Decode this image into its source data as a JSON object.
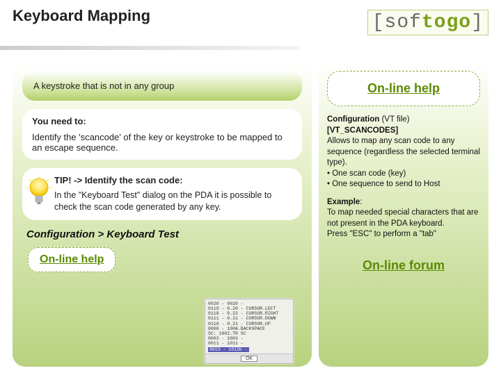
{
  "header": {
    "title": "Keyboard Mapping",
    "logo_pre": "[sof",
    "logo_accent": "togo",
    "logo_post": "]"
  },
  "left": {
    "banner": "A keystroke that is not in any group",
    "need_heading": "You need to:",
    "need_text": "Identify the 'scancode' of the key or keystroke to be mapped to an escape sequence.",
    "tip_heading": "TIP! -> Identify the scan code:",
    "tip_text": "In the \"Keyboard Test\" dialog  on the PDA it is possible to check the scan code generated by any key.",
    "config_path": "Configuration >  Keyboard Test",
    "onhelp_label": "On-line help"
  },
  "pda": {
    "lines": [
      "0020 - 0020 -",
      "0119 - 0.20 - CURSOR.LEFT",
      "0118 - 0.22 - CURSOR.RIGHT",
      "0111 - 0.21 - CURSOR.DOWN",
      "0118 - 0.21 - CURSOR.UP",
      "0008 - 100A.BACKSPACE",
      "SC: 1002.TR SC",
      "0003 - 1003 -",
      "0011 - 1011 -"
    ],
    "highlight": "0013 - 1013b -",
    "ok_label": "OK"
  },
  "right": {
    "onhelp_label": "On-line help",
    "config_heading": "Configuration",
    "config_suffix": " (VT file)",
    "section": "[VT_SCANCODES]",
    "desc": "Allows to map any scan code to any sequence (regardless the selected terminal type).",
    "bullet1": " One scan code (key)",
    "bullet2": " One sequence to send to Host",
    "example_heading": "Example",
    "example_text": "To map needed special characters that are not present in the PDA keyboard.\nPress \"ESC\" to perform a \"tab\"",
    "forum_label": "On-line forum"
  }
}
